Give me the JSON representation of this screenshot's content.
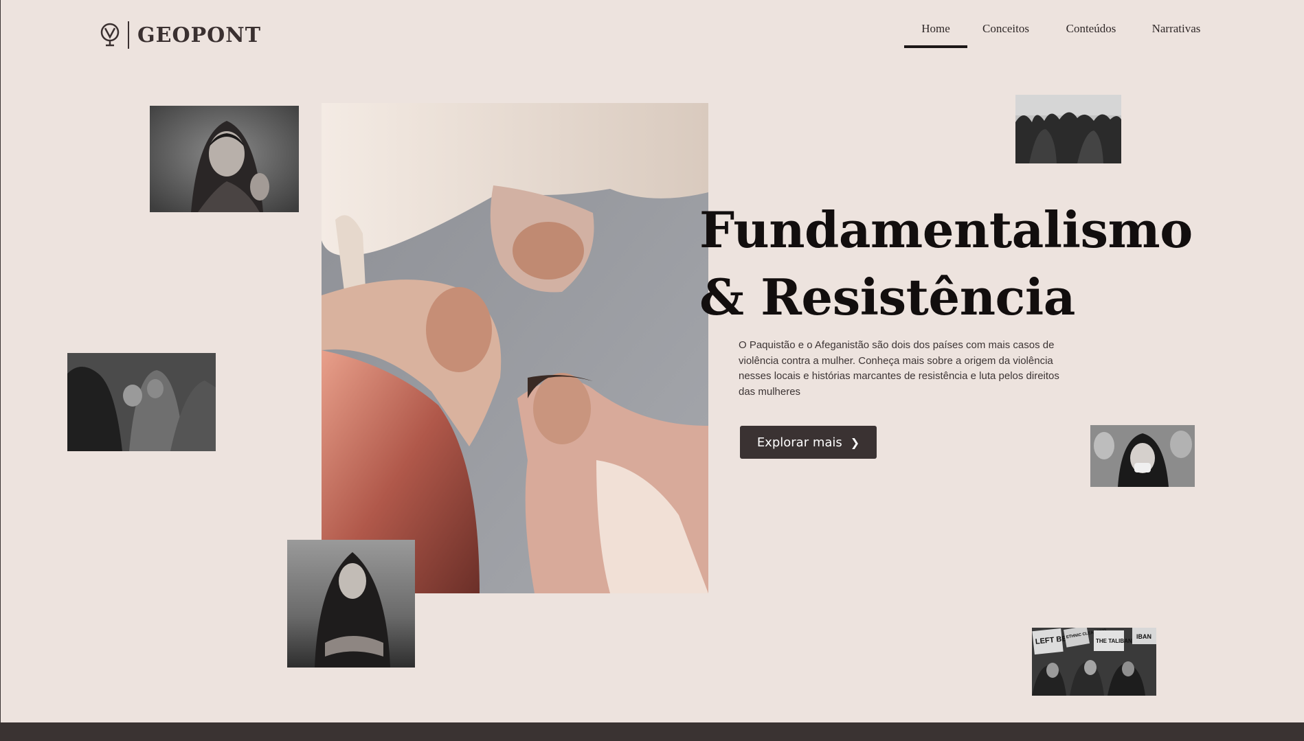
{
  "brand": {
    "name": "GEOPONT",
    "logo_icon": "globe-pin-icon"
  },
  "nav": {
    "items": [
      {
        "label": "Home",
        "active": true
      },
      {
        "label": "Conceitos",
        "active": false
      },
      {
        "label": "Conteúdos",
        "active": false
      },
      {
        "label": "Narrativas",
        "active": false
      }
    ]
  },
  "hero": {
    "title_line1": "Fundamentalismo",
    "title_line2": "& Resistência",
    "description": "O Paquistão e o Afeganistão são dois dos países com mais casos de violência contra a mulher. Conheça mais sobre a origem da violência nesses locais e histórias marcantes de resistência e luta pelos direitos das mulheres",
    "cta_label": "Explorar mais",
    "cta_icon": "chevron-right-icon"
  },
  "protest_signs": {
    "left_behind": "LEFT BEHIND",
    "ethnic_cleansing": "ETHNIC CLEANSING",
    "the_taliban": "THE TALIBAN",
    "iban": "IBAN"
  },
  "colors": {
    "background": "#ede3de",
    "text_dark": "#120e0e",
    "button": "#3a3232",
    "footer": "#3a3332"
  }
}
